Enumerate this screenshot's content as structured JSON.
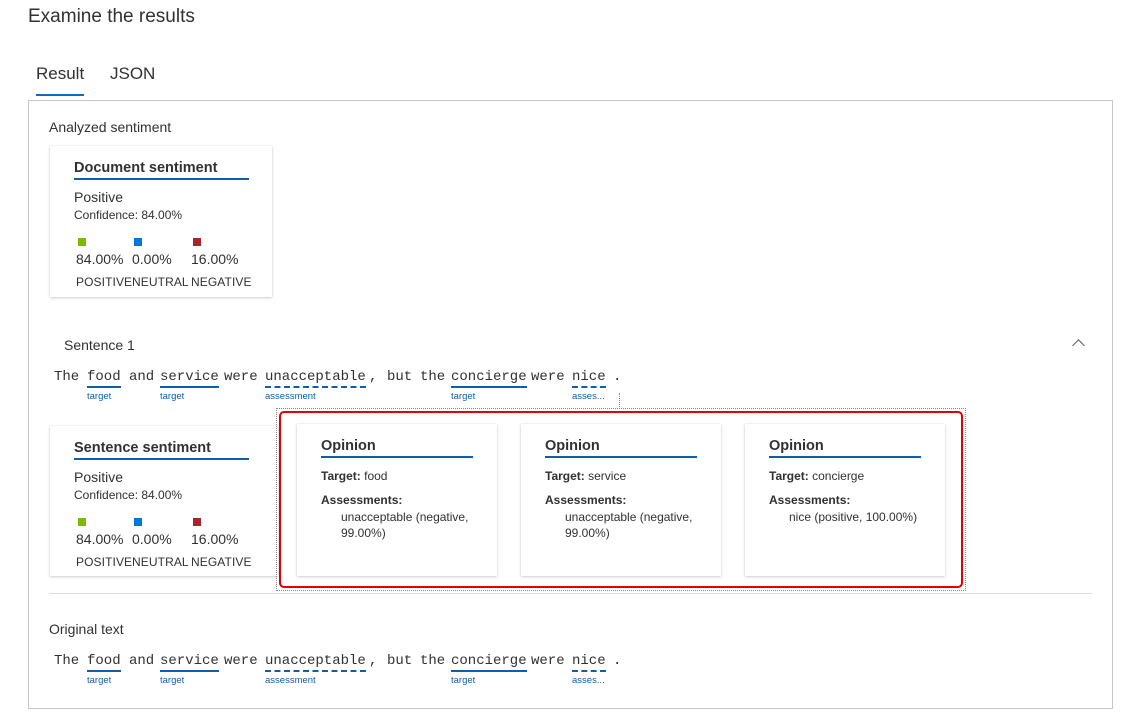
{
  "heading": "Examine the results",
  "tabs": [
    {
      "label": "Result"
    },
    {
      "label": "JSON"
    }
  ],
  "analyzed_label": "Analyzed sentiment",
  "document_card": {
    "title": "Document sentiment",
    "sentiment": "Positive",
    "confidence": "Confidence: 84.00%",
    "scores": [
      {
        "value": "84.00%",
        "label": "POSITIVE",
        "color": "#7fba00"
      },
      {
        "value": "0.00%",
        "label": "NEUTRAL",
        "color": "#0078d4"
      },
      {
        "value": "16.00%",
        "label": "NEGATIVE",
        "color": "#a4262c"
      }
    ]
  },
  "sentence": {
    "title": "Sentence 1",
    "collapse_icon": "chevron-up-icon",
    "tokens": [
      {
        "text": "The",
        "kind": "plain",
        "tag": ""
      },
      {
        "text": "food",
        "kind": "target",
        "tag": "target"
      },
      {
        "text": "and",
        "kind": "plain",
        "tag": ""
      },
      {
        "text": "service",
        "kind": "target",
        "tag": "target"
      },
      {
        "text": "were",
        "kind": "plain",
        "tag": ""
      },
      {
        "text": "unacceptable",
        "kind": "assessment",
        "tag": "assessment"
      },
      {
        "text": ",",
        "kind": "plain",
        "tag": ""
      },
      {
        "text": "but",
        "kind": "plain",
        "tag": ""
      },
      {
        "text": "the",
        "kind": "plain",
        "tag": ""
      },
      {
        "text": "concierge",
        "kind": "target",
        "tag": "target"
      },
      {
        "text": "were",
        "kind": "plain",
        "tag": ""
      },
      {
        "text": "nice",
        "kind": "assessment",
        "tag": "asses..."
      },
      {
        "text": ".",
        "kind": "plain",
        "tag": ""
      }
    ],
    "sentiment_card": {
      "title": "Sentence sentiment",
      "sentiment": "Positive",
      "confidence": "Confidence: 84.00%",
      "scores": [
        {
          "value": "84.00%",
          "label": "POSITIVE",
          "color": "#7fba00"
        },
        {
          "value": "0.00%",
          "label": "NEUTRAL",
          "color": "#0078d4"
        },
        {
          "value": "16.00%",
          "label": "NEGATIVE",
          "color": "#a4262c"
        }
      ]
    },
    "opinions": [
      {
        "title": "Opinion",
        "target_label": "Target:",
        "target": "food",
        "assessments_label": "Assessments:",
        "assessment": "unacceptable (negative, 99.00%)"
      },
      {
        "title": "Opinion",
        "target_label": "Target:",
        "target": "service",
        "assessments_label": "Assessments:",
        "assessment": "unacceptable (negative, 99.00%)"
      },
      {
        "title": "Opinion",
        "target_label": "Target:",
        "target": "concierge",
        "assessments_label": "Assessments:",
        "assessment": "nice (positive, 100.00%)"
      }
    ]
  },
  "original_label": "Original text",
  "colors": {
    "accent": "#0f5fa8",
    "highlight": "#e00000"
  }
}
